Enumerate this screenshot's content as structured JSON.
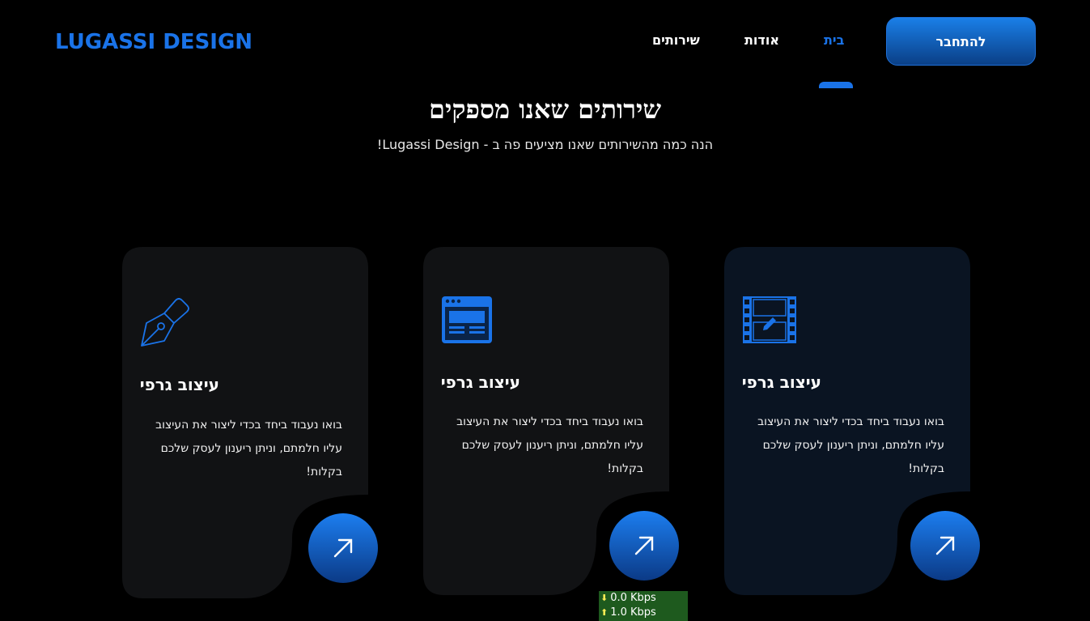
{
  "header": {
    "logo": "LUGASSI DESIGN",
    "nav": [
      {
        "label": "שירותים"
      },
      {
        "label": "אודות"
      },
      {
        "label": "בית",
        "active": true
      }
    ],
    "connect_label": "להתחבר"
  },
  "section": {
    "title": "שירותים שאנו מספקים",
    "subtitle": "!Lugassi Design - הנה כמה מהשירותים שאנו מציעים פה ב"
  },
  "cards": [
    {
      "icon": "pen-nib-icon",
      "title": "עיצוב גרפי",
      "lines": [
        "בואו נעבוד ביחד בכדי ליצור את העיצוב",
        "עליו חלמתם, וניתן ריענון לעסק שלכם",
        "בקלות!"
      ]
    },
    {
      "icon": "web-page-icon",
      "title": "עיצוב גרפי",
      "lines": [
        "בואו נעבוד ביחד בכדי ליצור את העיצוב",
        "עליו חלמתם, וניתן ריענון לעסק שלכם",
        "בקלות!"
      ]
    },
    {
      "icon": "video-film-icon",
      "title": "עיצוב גרפי",
      "lines": [
        "בואו נעבוד ביחד בכדי ליצור את העיצוב",
        "עליו חלמתם, וניתן ריענון לעסק שלכם",
        "בקלות!"
      ]
    }
  ],
  "network": {
    "down": "0.0 Kbps",
    "up": "1.0 Kbps"
  },
  "colors": {
    "accent": "#1a73e8",
    "card_bg": "#111214",
    "card_bg_highlight": "#0a1422",
    "background": "#000000"
  }
}
